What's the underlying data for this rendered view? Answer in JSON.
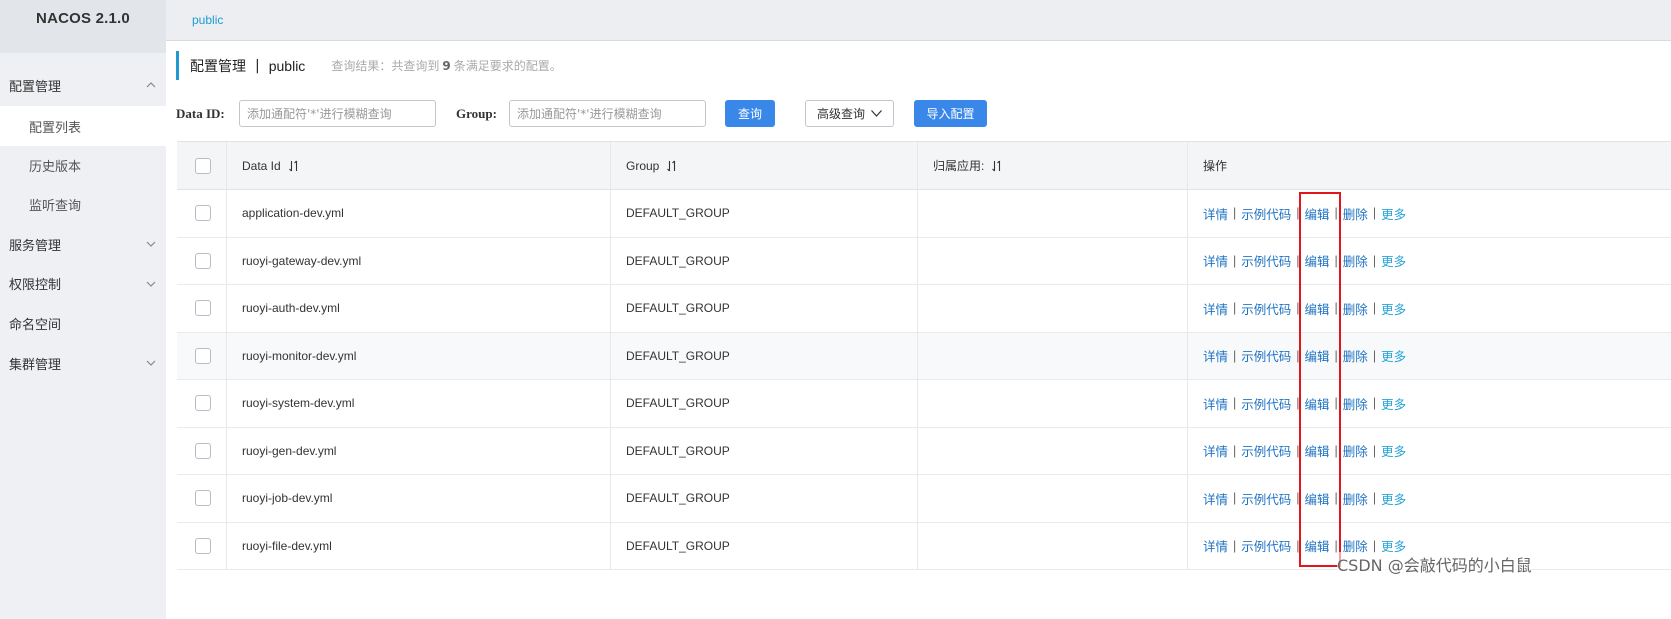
{
  "brand": "NACOS 2.1.0",
  "sidebar": {
    "config_mgmt": "配置管理",
    "config_list": "配置列表",
    "history": "历史版本",
    "listener": "监听查询",
    "service_mgmt": "服务管理",
    "auth": "权限控制",
    "namespace": "命名空间",
    "cluster": "集群管理"
  },
  "topbar": {
    "namespace_tab": "public"
  },
  "title": {
    "main": "配置管理",
    "sep": "|",
    "namespace": "public",
    "hint_prefix": "查询结果：共查询到",
    "hint_count": "9",
    "hint_suffix": "条满足要求的配置。"
  },
  "filter": {
    "dataid_label": "Data ID:",
    "dataid_placeholder": "添加通配符'*'进行模糊查询",
    "group_label": "Group:",
    "group_placeholder": "添加通配符'*'进行模糊查询",
    "search_btn": "查询",
    "advanced_btn": "高级查询",
    "import_btn": "导入配置"
  },
  "table": {
    "headers": {
      "data_id": "Data Id",
      "group": "Group",
      "app": "归属应用:",
      "ops": "操作"
    },
    "ops": {
      "detail": "详情",
      "sample": "示例代码",
      "edit": "编辑",
      "delete": "删除",
      "more": "更多",
      "sep": "|"
    },
    "rows": [
      {
        "data_id": "application-dev.yml",
        "group": "DEFAULT_GROUP",
        "app": ""
      },
      {
        "data_id": "ruoyi-gateway-dev.yml",
        "group": "DEFAULT_GROUP",
        "app": ""
      },
      {
        "data_id": "ruoyi-auth-dev.yml",
        "group": "DEFAULT_GROUP",
        "app": ""
      },
      {
        "data_id": "ruoyi-monitor-dev.yml",
        "group": "DEFAULT_GROUP",
        "app": ""
      },
      {
        "data_id": "ruoyi-system-dev.yml",
        "group": "DEFAULT_GROUP",
        "app": ""
      },
      {
        "data_id": "ruoyi-gen-dev.yml",
        "group": "DEFAULT_GROUP",
        "app": ""
      },
      {
        "data_id": "ruoyi-job-dev.yml",
        "group": "DEFAULT_GROUP",
        "app": ""
      },
      {
        "data_id": "ruoyi-file-dev.yml",
        "group": "DEFAULT_GROUP",
        "app": ""
      }
    ]
  },
  "watermark": "CSDN @会敲代码的小白鼠",
  "colors": {
    "accent": "#1f9bd1",
    "primary_button": "#3a87ea",
    "highlight": "#e3151b",
    "link": "#1f73c4"
  }
}
